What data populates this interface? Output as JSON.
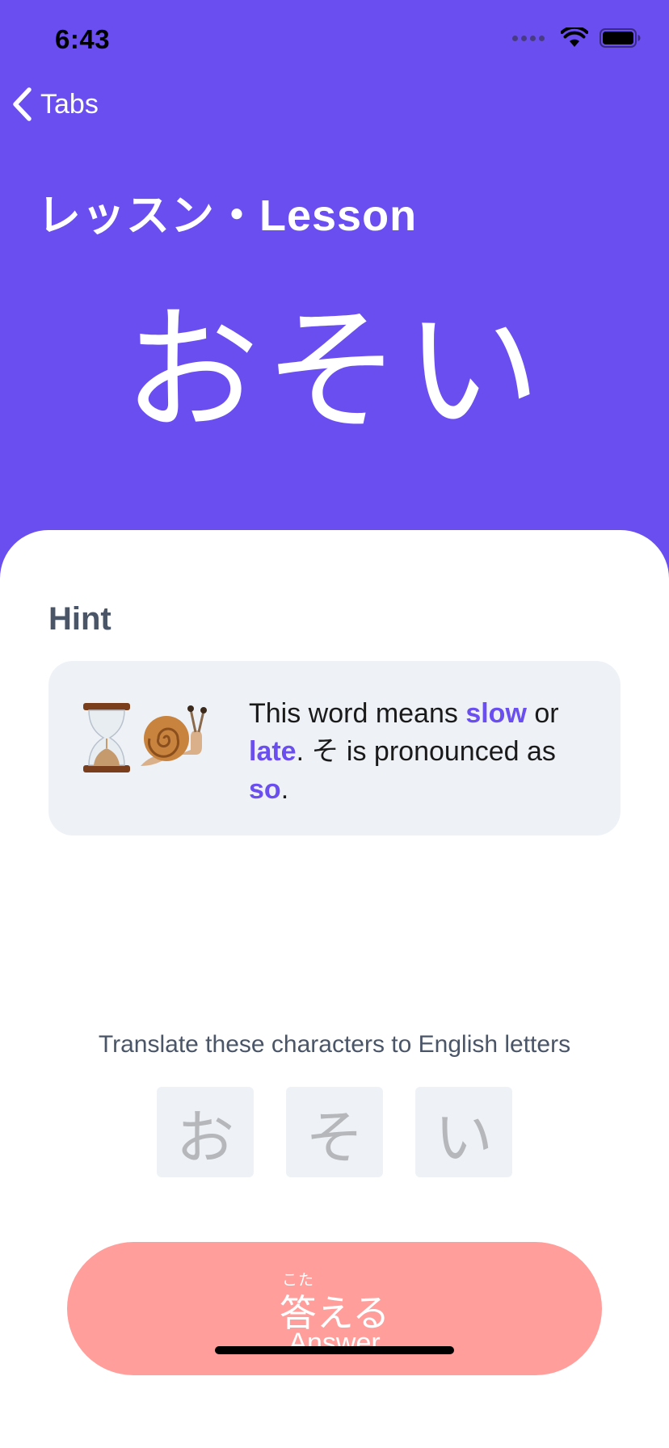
{
  "status_bar": {
    "time": "6:43",
    "icons": [
      "signal-dots-icon",
      "wifi-icon",
      "battery-icon"
    ]
  },
  "nav": {
    "back_label": "Tabs",
    "title": "レッスン・Lesson"
  },
  "word": "おそい",
  "hint": {
    "heading": "Hint",
    "emoji": [
      "hourglass-icon",
      "snail-icon"
    ],
    "text_1": "This word means ",
    "highlight_1": "slow",
    "text_2": " or ",
    "highlight_2": "late",
    "text_3": ". そ is pronounced as ",
    "highlight_3": "so",
    "text_4": "."
  },
  "instruction": "Translate these characters to English letters",
  "characters": [
    "お",
    "そ",
    "い"
  ],
  "answer_button": {
    "furigana": "こた",
    "label_jp": "答える",
    "label_en": "Answer"
  },
  "colors": {
    "accent": "#6B4EF0",
    "answer_button": "#FF9E9B",
    "card_bg": "#EEF2F7",
    "heading_text": "#4A5568",
    "tile_text": "#B5B7BA"
  }
}
